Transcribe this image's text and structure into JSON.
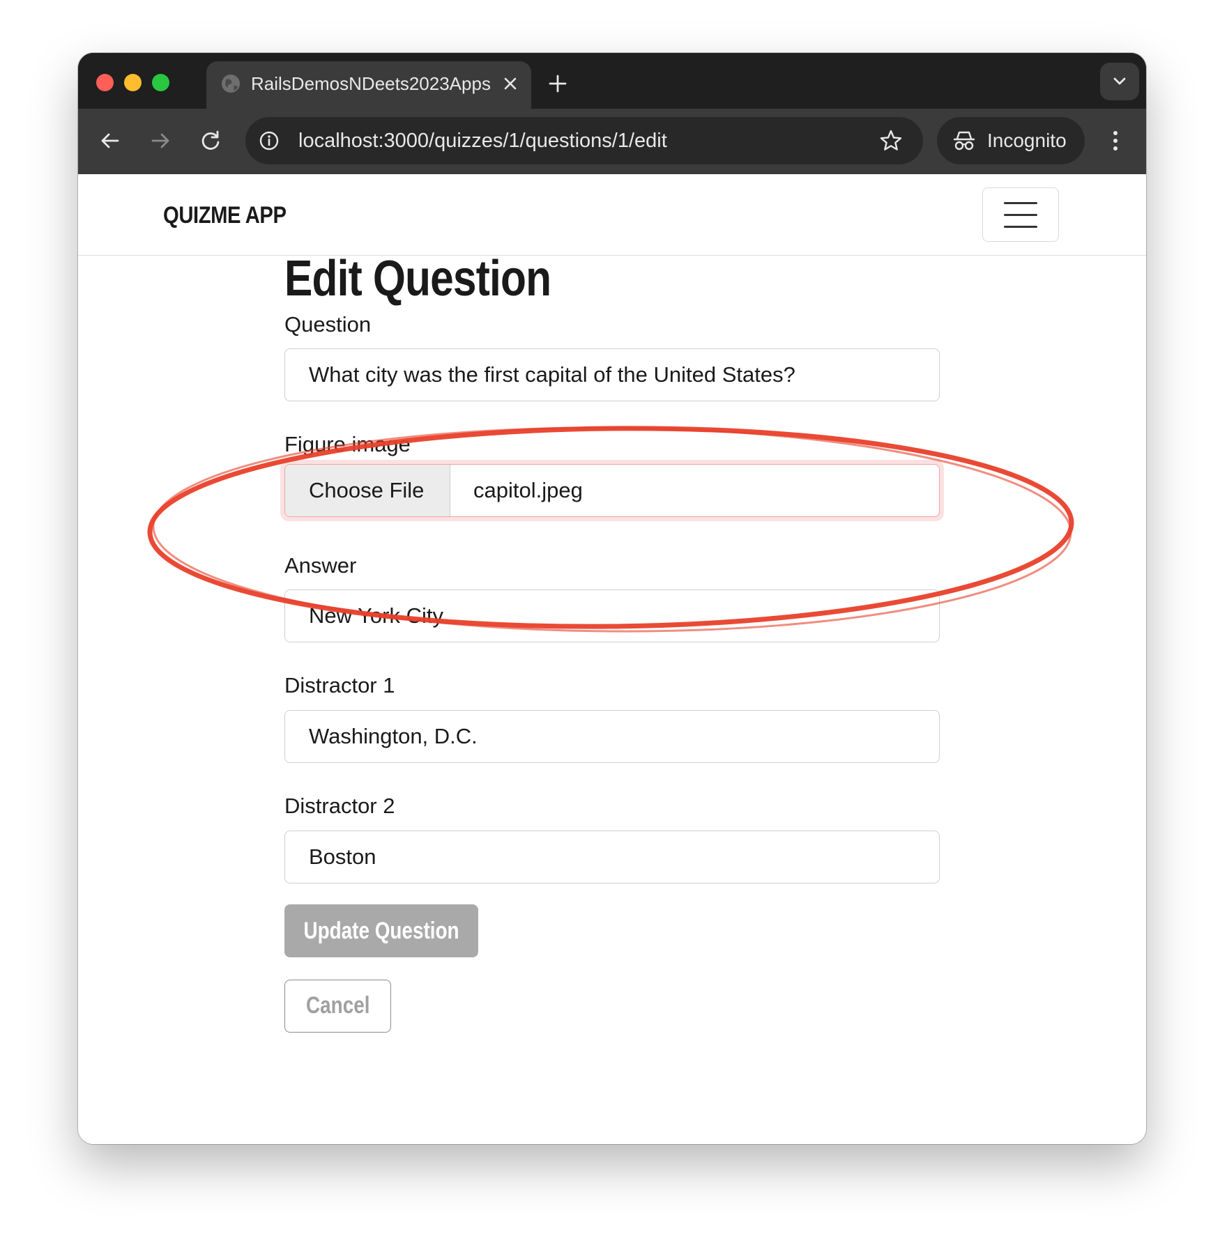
{
  "browser": {
    "tab_title": "RailsDemosNDeets2023Apps",
    "url": "localhost:3000/quizzes/1/questions/1/edit",
    "incognito_label": "Incognito",
    "icons": [
      "back-arrow-icon",
      "forward-arrow-icon",
      "reload-icon",
      "site-info-icon",
      "star-icon",
      "incognito-icon",
      "more-menu-icon",
      "tab-search-icon",
      "new-tab-icon",
      "close-tab-icon",
      "globe-icon"
    ],
    "traffic_colors": {
      "close": "#ff5f57",
      "minimize": "#febc2e",
      "maximize": "#28c840"
    }
  },
  "app": {
    "brand": "QUIZME APP"
  },
  "form": {
    "title": "Edit Question",
    "question_label": "Question",
    "question_value": "What city was the first capital of the United States?",
    "figure_label": "Figure image",
    "choose_file_label": "Choose File",
    "file_name": "capitol.jpeg",
    "answer_label": "Answer",
    "answer_value": "New York City",
    "distractor1_label": "Distractor 1",
    "distractor1_value": "Washington, D.C.",
    "distractor2_label": "Distractor 2",
    "distractor2_value": "Boston",
    "submit_label": "Update Question",
    "cancel_label": "Cancel"
  },
  "colors": {
    "annotation_red": "#e8402a",
    "update_button": "#a9a9a9"
  }
}
